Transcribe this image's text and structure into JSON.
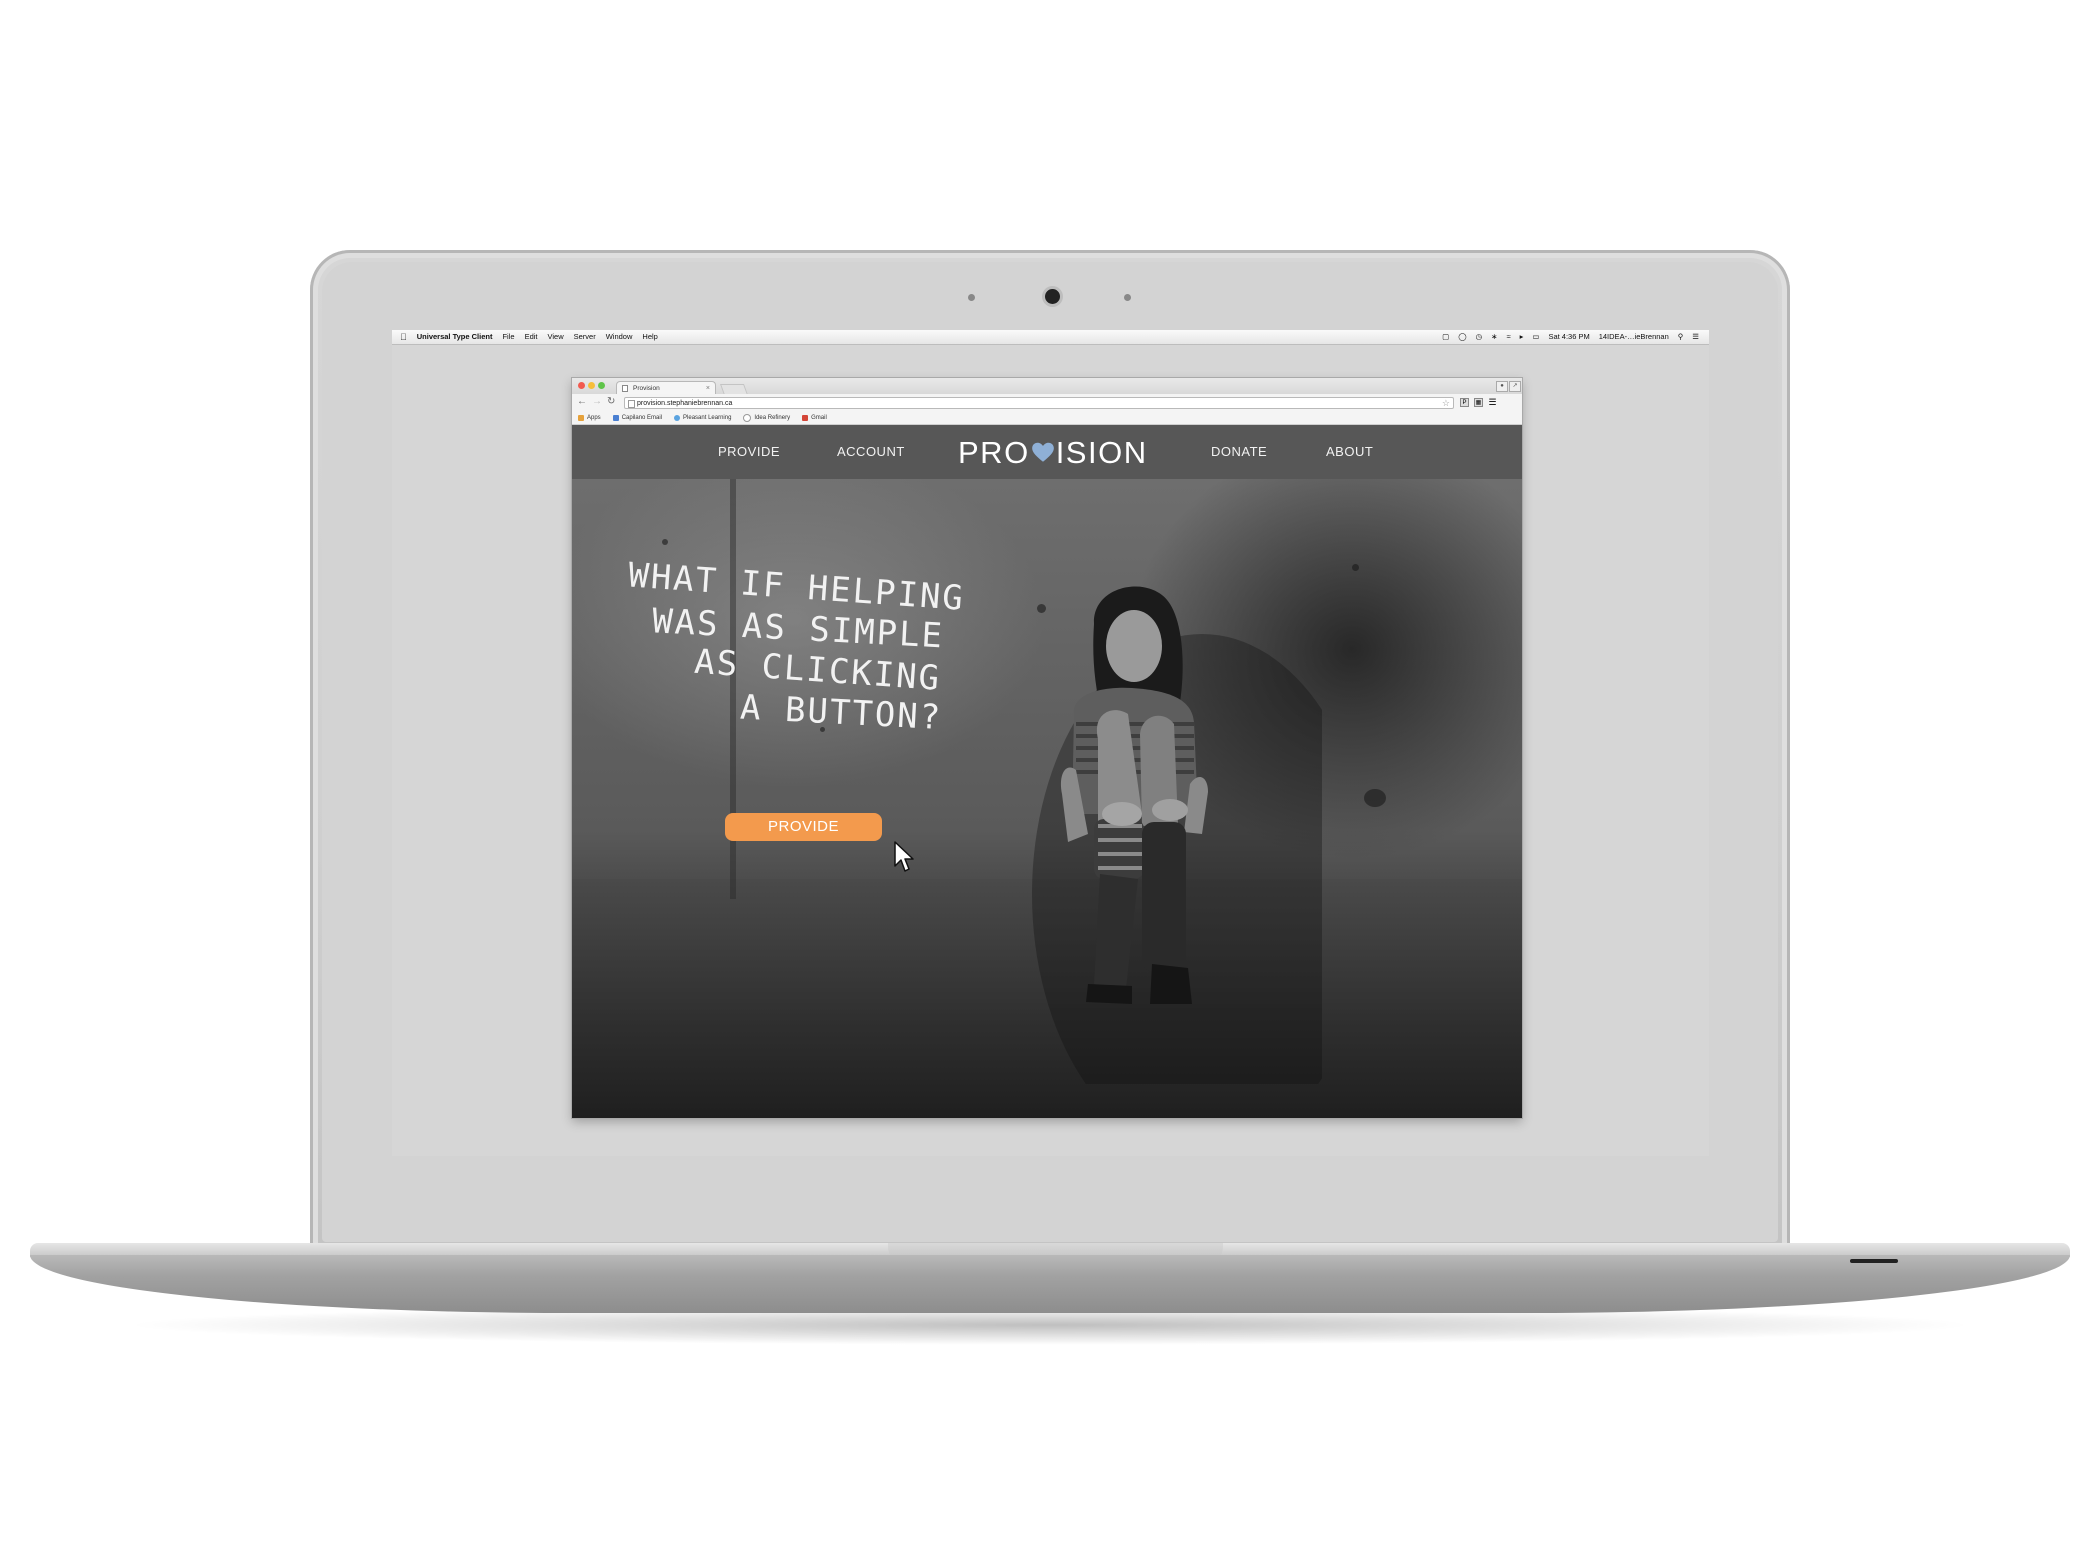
{
  "menubar": {
    "app_name": "Universal Type Client",
    "menus": [
      "File",
      "Edit",
      "View",
      "Server",
      "Window",
      "Help"
    ],
    "clock": "Sat 4:36 PM",
    "user": "14IDEA-…ieBrennan"
  },
  "browser": {
    "tab_title": "Provision",
    "url": "provision.stephaniebrennan.ca",
    "bookmarks": [
      {
        "label": "Apps",
        "color": "#e6a23c"
      },
      {
        "label": "Capilano Email",
        "color": "#4a7fd1"
      },
      {
        "label": "Pleasant Learning",
        "color": "#5aa3e0"
      },
      {
        "label": "Idea Refinery",
        "color": "#999999"
      },
      {
        "label": "Gmail",
        "color": "#d44638"
      }
    ]
  },
  "site": {
    "nav": {
      "provide": "PROVIDE",
      "account": "ACCOUNT",
      "logo_left": "PRO",
      "logo_right": "ISION",
      "donate": "DONATE",
      "about": "ABOUT"
    },
    "hero": {
      "line1": "What if helping",
      "line2": "was as simple",
      "line3": "as clicking",
      "line4": "a button?",
      "cta": "PROVIDE"
    },
    "colors": {
      "accent": "#f39a4d",
      "heart": "#8fb0d6",
      "nav_bg": "#575757"
    }
  }
}
